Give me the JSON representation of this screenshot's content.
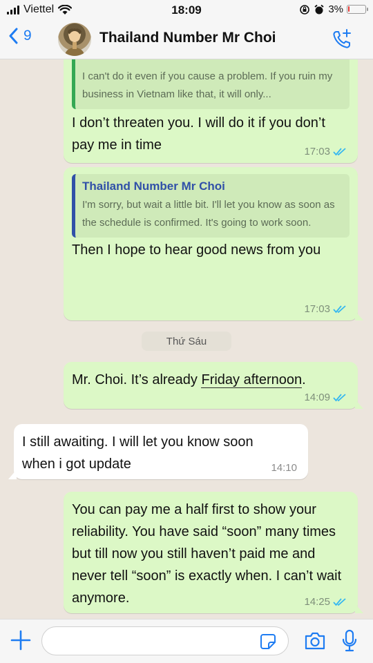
{
  "status_bar": {
    "carrier": "Viettel",
    "time": "18:09",
    "battery": "3%",
    "battery_level": 0.03
  },
  "header": {
    "back_count": "9",
    "title": "Thailand Number Mr Choi"
  },
  "messages": {
    "m1": {
      "quote_text": "I can't do it even if you cause a problem. If you ruin my business in Vietnam like that, it will only...",
      "text": "I don’t threaten you. I will do it if you don’t pay me in time",
      "time": "17:03"
    },
    "m2": {
      "quote_author": "Thailand Number Mr Choi",
      "quote_text": "I'm sorry, but wait a little bit. I'll let you know as soon as the schedule is confirmed. It's going to work soon.",
      "text": "Then I hope to hear good news from you",
      "time": "17:03"
    },
    "day_separator": "Thứ Sáu",
    "m3": {
      "text_before": "Mr. Choi. It’s already ",
      "link": "Friday afternoon",
      "text_after": ".",
      "time": "14:09"
    },
    "m4": {
      "text": "I still awaiting. I will let you know soon when i got update",
      "time": "14:10"
    },
    "m5": {
      "text": "You can pay me a half first to show your reliability. You have said “soon” many times but till now you still haven’t paid me and never tell “soon” is exactly when. I can’t wait anymore.",
      "time": "14:25"
    }
  },
  "input": {
    "value": "",
    "placeholder": ""
  },
  "colors": {
    "accent": "#1e7cf2",
    "outgoing": "#dcf8c6",
    "incoming": "#ffffff",
    "read_ticks": "#34b7f1",
    "chat_bg": "#ece5dd"
  },
  "icons": [
    "signal-icon",
    "wifi-icon",
    "alarm-icon",
    "battery-icon",
    "back-chevron-icon",
    "add-call-icon",
    "read-ticks-icon",
    "plus-icon",
    "sticker-icon",
    "camera-icon",
    "mic-icon"
  ]
}
